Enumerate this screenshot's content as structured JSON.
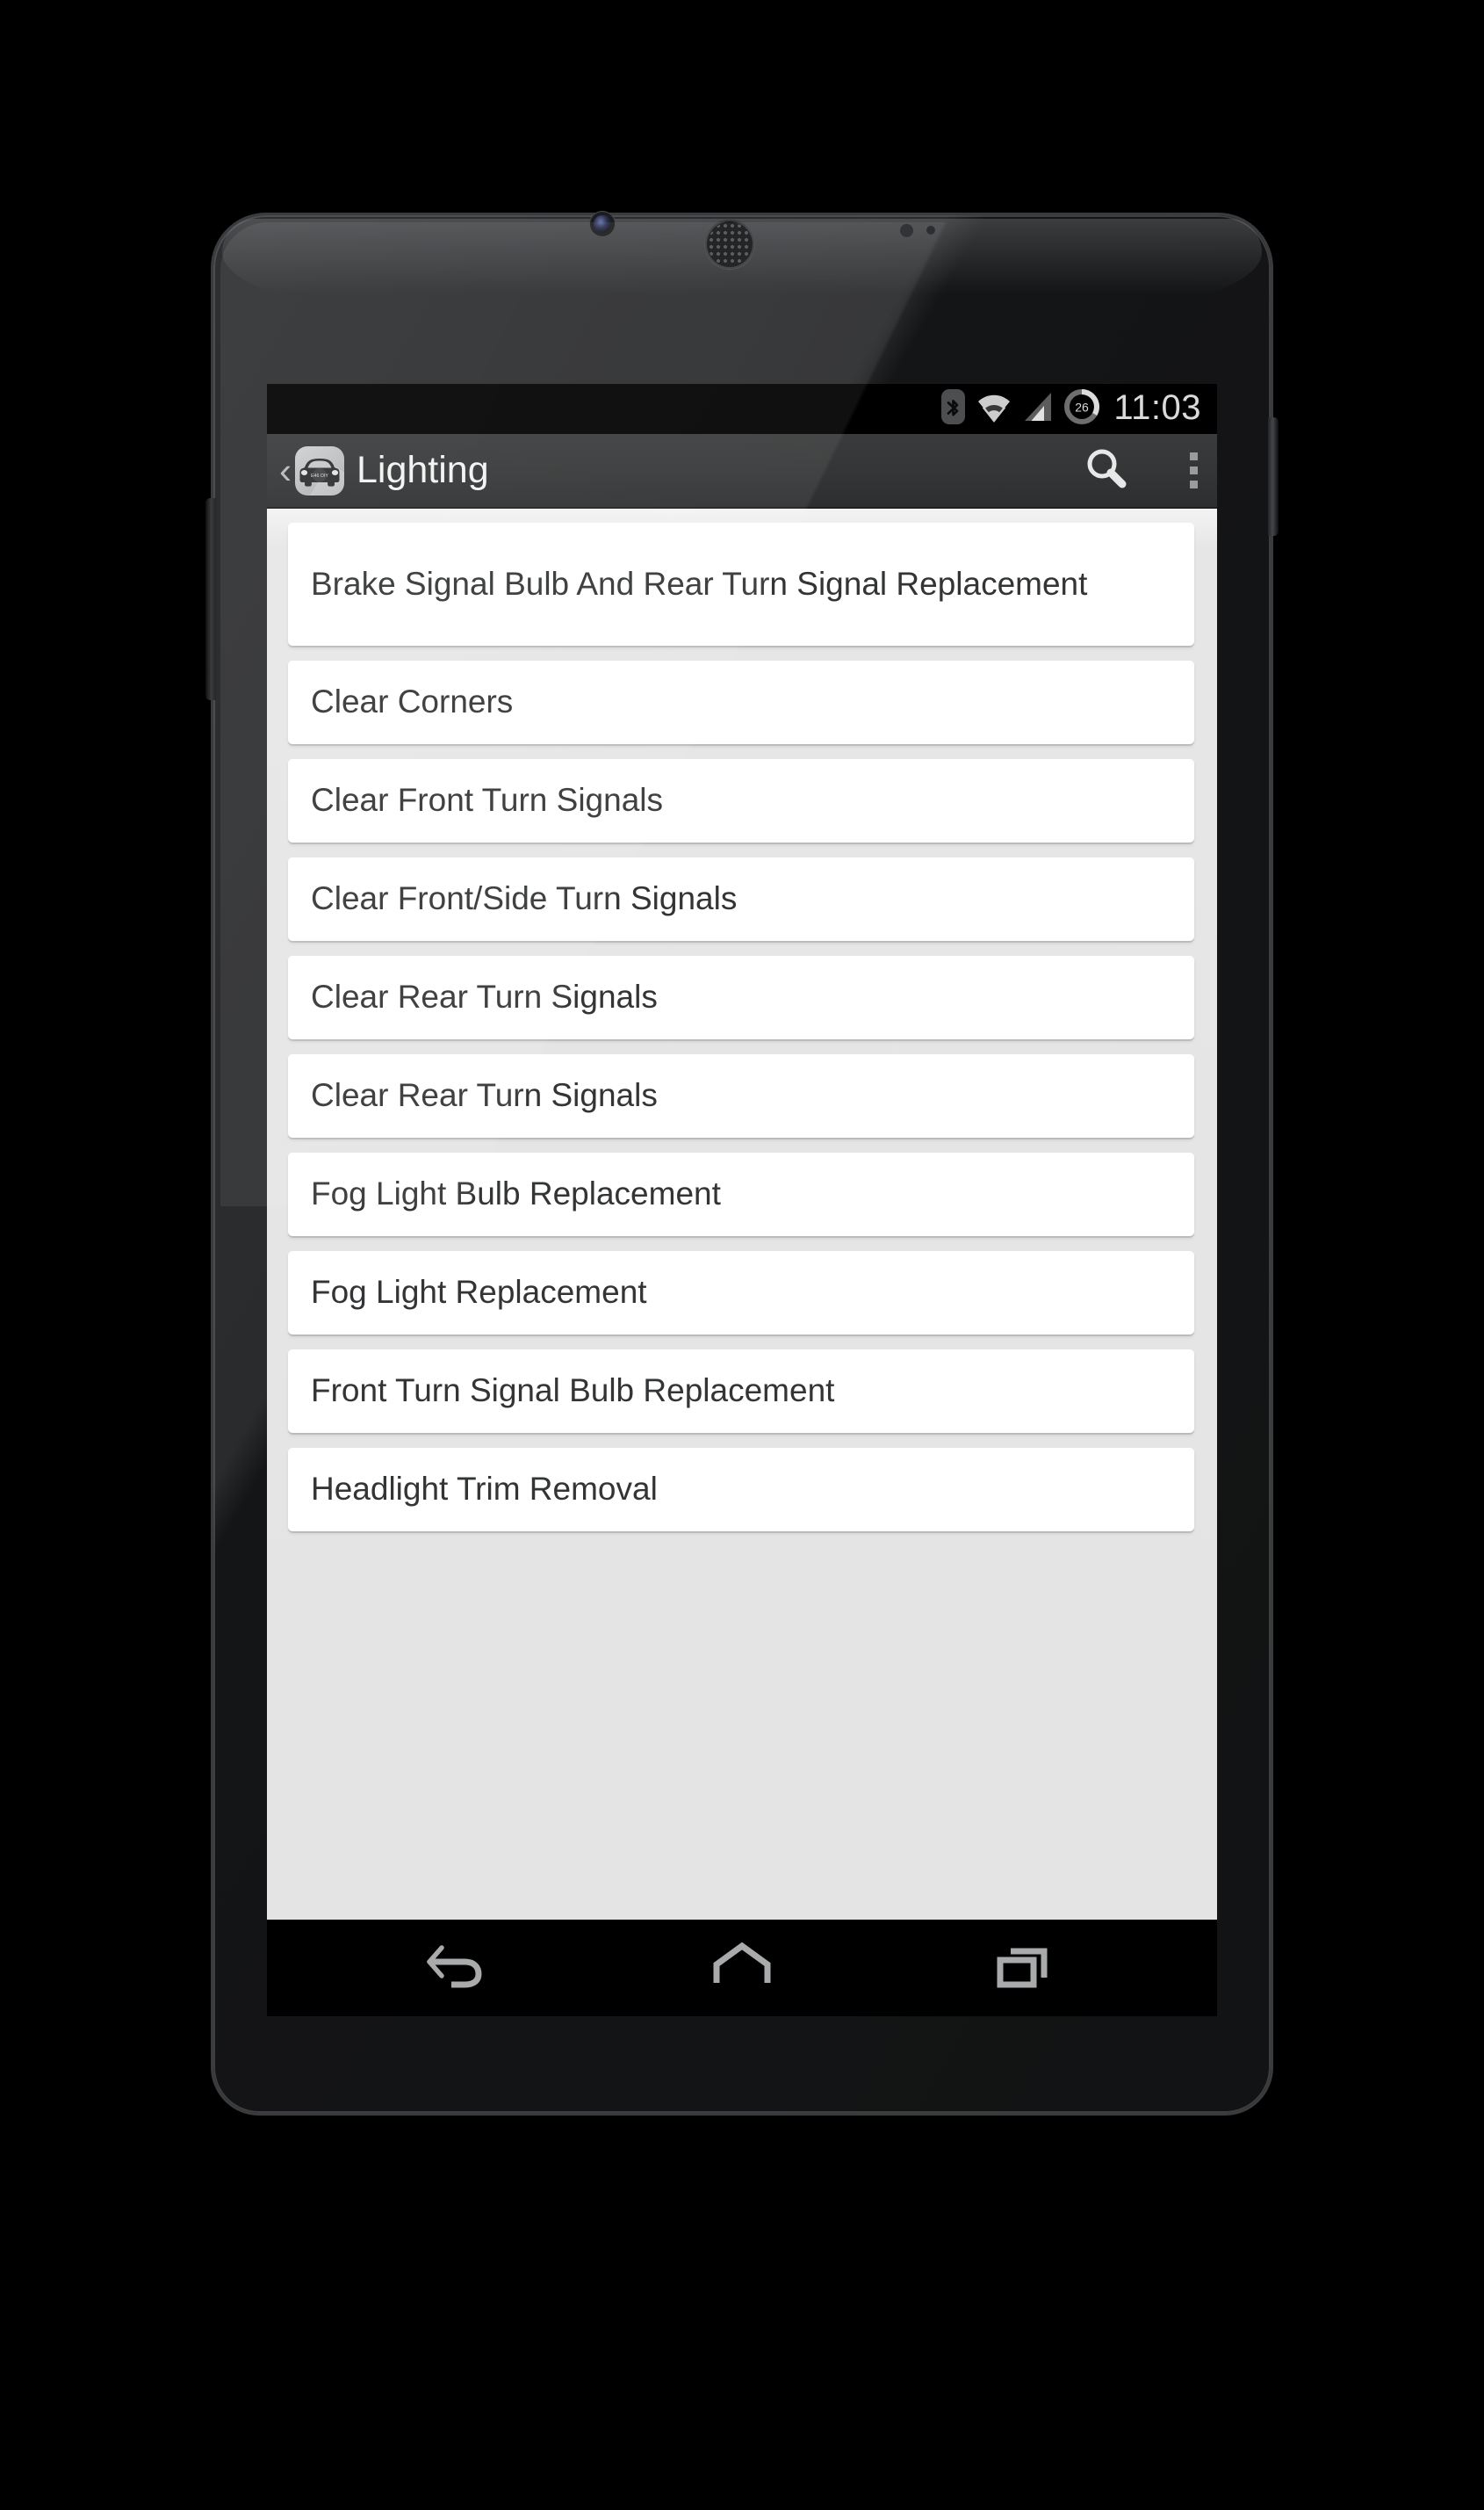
{
  "device": {
    "name": "android-phone",
    "hardware": {
      "front_camera": "front-camera",
      "earpiece": "earpiece-speaker",
      "proximity_sensor": "proximity-sensor",
      "volume_rocker": "volume-rocker",
      "power_button": "power-button"
    }
  },
  "status_bar": {
    "icons": [
      {
        "name": "bluetooth-icon",
        "label": "Bluetooth"
      },
      {
        "name": "wifi-icon",
        "label": "Wi-Fi"
      },
      {
        "name": "cellular-signal-icon",
        "label": "Cellular signal"
      },
      {
        "name": "battery-icon",
        "label": "Battery"
      }
    ],
    "battery_level": "26",
    "time": "11:03"
  },
  "action_bar": {
    "back_chevron": "‹",
    "app_icon": {
      "name": "car-app-icon",
      "plate_text": "E46 DIY"
    },
    "title": "Lighting",
    "search_label": "Search",
    "overflow_label": "More options"
  },
  "list": {
    "items": [
      {
        "label": "Brake Signal Bulb And Rear Turn Signal Replacement",
        "lines": 2
      },
      {
        "label": "Clear Corners",
        "lines": 1
      },
      {
        "label": "Clear Front Turn Signals",
        "lines": 1
      },
      {
        "label": "Clear Front/Side Turn Signals",
        "lines": 1
      },
      {
        "label": "Clear Rear Turn Signals",
        "lines": 1
      },
      {
        "label": "Clear Rear Turn Signals",
        "lines": 1
      },
      {
        "label": "Fog Light Bulb Replacement",
        "lines": 1
      },
      {
        "label": "Fog Light Replacement",
        "lines": 1
      },
      {
        "label": "Front Turn Signal Bulb Replacement",
        "lines": 1
      },
      {
        "label": "Headlight Trim Removal",
        "lines": 1
      }
    ]
  },
  "nav_bar": {
    "buttons": [
      {
        "name": "back-button",
        "label": "Back"
      },
      {
        "name": "home-button",
        "label": "Home"
      },
      {
        "name": "recents-button",
        "label": "Recent apps"
      }
    ]
  },
  "colors": {
    "background": "#000000",
    "action_bar": "#343536",
    "content_background": "#e4e4e4",
    "card": "#ffffff",
    "card_text": "#333435",
    "status_text": "#dadada"
  }
}
